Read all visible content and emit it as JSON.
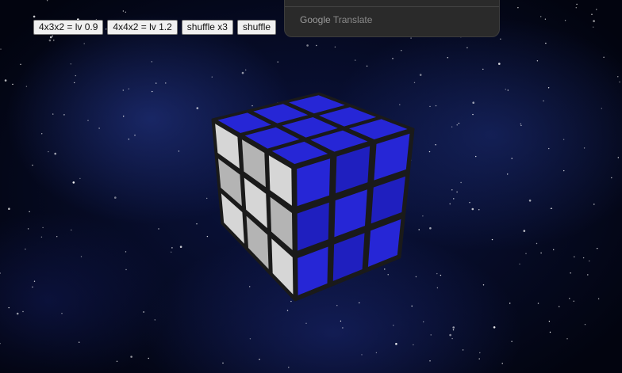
{
  "toolbar": {
    "buttons": [
      {
        "label": "4x3x2 = lv 0.9"
      },
      {
        "label": "4x4x2 = lv 1.2"
      },
      {
        "label": "shuffle x3"
      },
      {
        "label": "shuffle"
      }
    ]
  },
  "translate_popup": {
    "brand_google": "Google",
    "brand_translate": "Translate"
  },
  "cube": {
    "size": "3x3x3",
    "faces": {
      "top": "blue",
      "front": "blue",
      "left": "white"
    },
    "colors": {
      "blue": "#2626d6",
      "blue_dark": "#1f1fbf",
      "white": "#d6d6d6",
      "white_dark": "#b4b4b4",
      "border": "#1a1a1a"
    }
  }
}
